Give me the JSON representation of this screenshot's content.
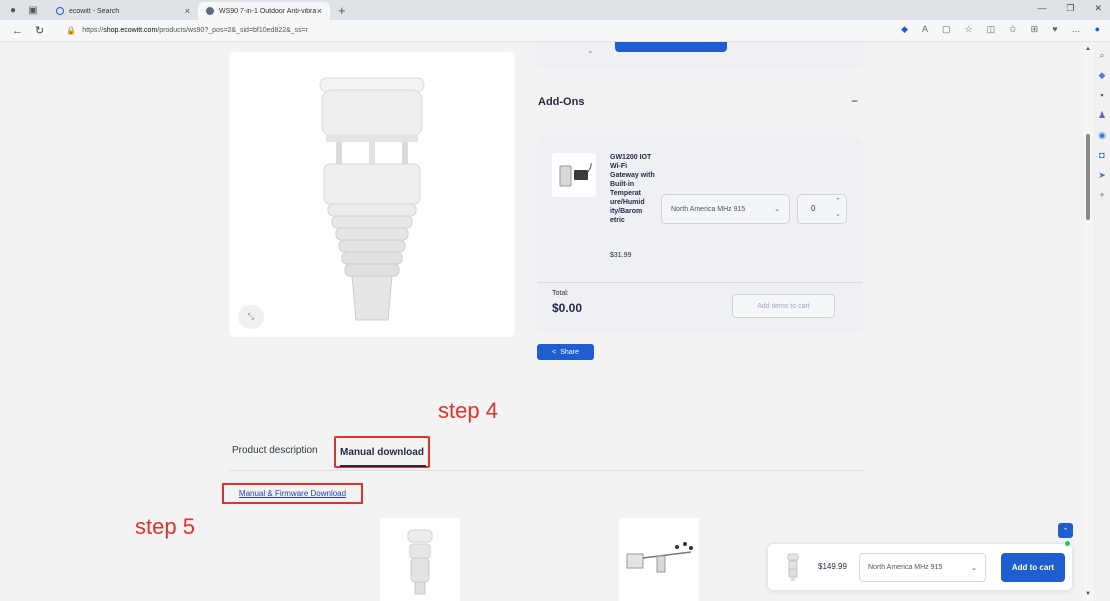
{
  "browser": {
    "tabs": [
      {
        "title": "ecowitt - Search",
        "active": false
      },
      {
        "title": "WS90 7-in-1 Outdoor Anti-vibra",
        "active": true
      }
    ],
    "url_prefix": "https://",
    "url_domain": "shop.ecowitt.com",
    "url_path": "/products/ws90?_pos=2&_sid=bf10ed822&_ss=r"
  },
  "addons": {
    "title": "Add-Ons",
    "collapse_symbol": "−",
    "item": {
      "name": "GW1200 IOT Wi-Fi Gateway with Built-in Temperat ure/Humid ity/Barom etric",
      "price": "$31.99",
      "region": "North America MHz 915",
      "qty": "0"
    },
    "total_label": "Total:",
    "total_value": "$0.00",
    "add_items_label": "Add items to cart"
  },
  "share_label": "Share",
  "annotations": {
    "step4": "step 4",
    "step5": "step 5"
  },
  "tabs": {
    "description": "Product description",
    "manual": "Manual download"
  },
  "manual_link": "Manual & Firmware Download",
  "sticky_cart": {
    "price": "$149.99",
    "region": "North America MHz 915",
    "add_label": "Add to cart"
  },
  "colors": {
    "accent": "#1f5ed1",
    "annotation": "#e0322e",
    "status": "#22c55e"
  }
}
